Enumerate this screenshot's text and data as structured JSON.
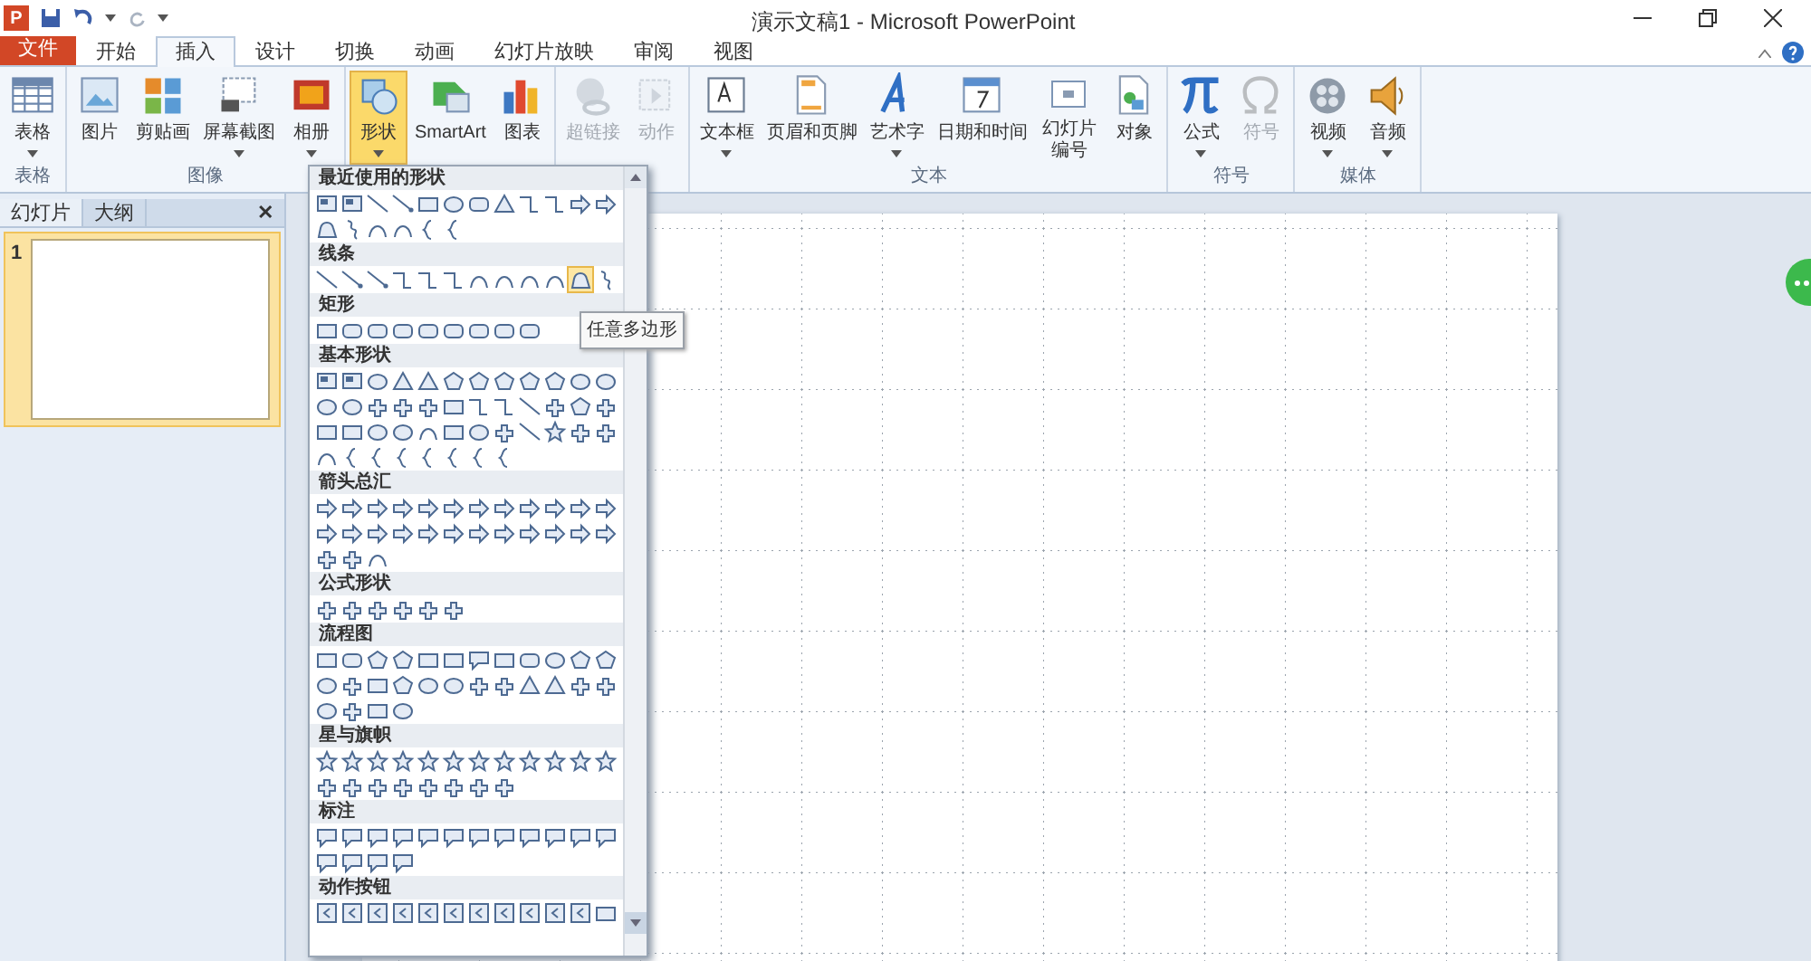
{
  "window": {
    "logo": "P",
    "title": "演示文稿1 - Microsoft PowerPoint"
  },
  "file_tab": "文件",
  "tabs": [
    {
      "label": "开始",
      "selected": false
    },
    {
      "label": "插入",
      "selected": true
    },
    {
      "label": "设计",
      "selected": false
    },
    {
      "label": "切换",
      "selected": false
    },
    {
      "label": "动画",
      "selected": false
    },
    {
      "label": "幻灯片放映",
      "selected": false
    },
    {
      "label": "审阅",
      "selected": false
    },
    {
      "label": "视图",
      "selected": false
    }
  ],
  "ribbon": [
    {
      "label": "表格",
      "buttons": [
        {
          "label": "表格",
          "dropdown": true,
          "disabled": false,
          "pressed": false
        }
      ]
    },
    {
      "label": "图像",
      "buttons": [
        {
          "label": "图片",
          "dropdown": false,
          "disabled": false,
          "pressed": false
        },
        {
          "label": "剪贴画",
          "dropdown": false,
          "disabled": false,
          "pressed": false
        },
        {
          "label": "屏幕截图",
          "dropdown": true,
          "disabled": false,
          "pressed": false
        },
        {
          "label": "相册",
          "dropdown": true,
          "disabled": false,
          "pressed": false
        }
      ]
    },
    {
      "buttons": [
        {
          "label": "形状",
          "dropdown": true,
          "disabled": false,
          "pressed": true
        },
        {
          "label": "SmartArt",
          "dropdown": false,
          "disabled": false,
          "pressed": false
        },
        {
          "label": "图表",
          "dropdown": false,
          "disabled": false,
          "pressed": false
        }
      ]
    },
    {
      "buttons": [
        {
          "label": "超链接",
          "dropdown": false,
          "disabled": true,
          "pressed": false
        },
        {
          "label": "动作",
          "dropdown": false,
          "disabled": true,
          "pressed": false
        }
      ]
    },
    {
      "label": "文本",
      "buttons": [
        {
          "label": "文本框",
          "dropdown": true,
          "disabled": false,
          "pressed": false
        },
        {
          "label": "页眉和页脚",
          "dropdown": false,
          "disabled": false,
          "pressed": false
        },
        {
          "label": "艺术字",
          "dropdown": true,
          "disabled": false,
          "pressed": false
        },
        {
          "label": "日期和时间",
          "dropdown": false,
          "disabled": false,
          "pressed": false
        },
        {
          "label": "幻灯片编号",
          "dropdown": false,
          "disabled": false,
          "pressed": false
        },
        {
          "label": "对象",
          "dropdown": false,
          "disabled": false,
          "pressed": false
        }
      ]
    },
    {
      "label": "符号",
      "buttons": [
        {
          "label": "公式",
          "dropdown": true,
          "disabled": false,
          "pressed": false
        },
        {
          "label": "符号",
          "dropdown": false,
          "disabled": true,
          "pressed": false
        }
      ]
    },
    {
      "label": "媒体",
      "buttons": [
        {
          "label": "视频",
          "dropdown": true,
          "disabled": false,
          "pressed": false
        },
        {
          "label": "音频",
          "dropdown": true,
          "disabled": false,
          "pressed": false
        }
      ]
    }
  ],
  "side_panel": {
    "tabs": [
      {
        "label": "幻灯片",
        "selected": true
      },
      {
        "label": "大纲",
        "selected": false
      }
    ],
    "close": "✕",
    "slides": [
      {
        "number": "1",
        "selected": true
      }
    ]
  },
  "shapes_gallery": {
    "sections": [
      {
        "title": "最近使用的形状",
        "shapes": [
          {
            "kind": "image"
          },
          {
            "kind": "image"
          },
          {
            "kind": "line"
          },
          {
            "kind": "arrowline"
          },
          {
            "kind": "rect"
          },
          {
            "kind": "oval"
          },
          {
            "kind": "round"
          },
          {
            "kind": "triangle"
          },
          {
            "kind": "elbow"
          },
          {
            "kind": "elbow"
          },
          {
            "kind": "arrow"
          },
          {
            "kind": "arrow"
          },
          {
            "kind": "freeform"
          },
          {
            "kind": "scribble"
          },
          {
            "kind": "curve"
          },
          {
            "kind": "curve"
          },
          {
            "kind": "brace"
          },
          {
            "kind": "brace"
          }
        ]
      },
      {
        "title": "线条",
        "shapes": [
          {
            "kind": "line",
            "selected": false
          },
          {
            "kind": "arrowline",
            "selected": false
          },
          {
            "kind": "arrowline",
            "selected": false
          },
          {
            "kind": "elbow",
            "selected": false
          },
          {
            "kind": "elbow",
            "selected": false
          },
          {
            "kind": "elbow",
            "selected": false
          },
          {
            "kind": "curve",
            "selected": false
          },
          {
            "kind": "curve",
            "selected": false
          },
          {
            "kind": "curve",
            "selected": false
          },
          {
            "kind": "curve",
            "selected": false
          },
          {
            "kind": "freeform",
            "selected": true
          },
          {
            "kind": "scribble",
            "selected": false
          }
        ]
      },
      {
        "title": "矩形",
        "shapes": [
          {
            "kind": "rect"
          },
          {
            "kind": "round"
          },
          {
            "kind": "round"
          },
          {
            "kind": "round"
          },
          {
            "kind": "round"
          },
          {
            "kind": "round"
          },
          {
            "kind": "round"
          },
          {
            "kind": "round"
          },
          {
            "kind": "round"
          }
        ]
      },
      {
        "title": "基本形状",
        "shapes": [
          {
            "kind": "image"
          },
          {
            "kind": "image"
          },
          {
            "kind": "oval"
          },
          {
            "kind": "triangle"
          },
          {
            "kind": "triangle"
          },
          {
            "kind": "polygon"
          },
          {
            "kind": "polygon"
          },
          {
            "kind": "polygon"
          },
          {
            "kind": "polygon"
          },
          {
            "kind": "polygon"
          },
          {
            "kind": "oval"
          },
          {
            "kind": "oval"
          },
          {
            "kind": "oval"
          },
          {
            "kind": "oval"
          },
          {
            "kind": "misc"
          },
          {
            "kind": "misc"
          },
          {
            "kind": "misc"
          },
          {
            "kind": "rect"
          },
          {
            "kind": "elbow"
          },
          {
            "kind": "elbow"
          },
          {
            "kind": "line"
          },
          {
            "kind": "misc"
          },
          {
            "kind": "polygon"
          },
          {
            "kind": "misc"
          },
          {
            "kind": "rect"
          },
          {
            "kind": "rect"
          },
          {
            "kind": "oval"
          },
          {
            "kind": "oval"
          },
          {
            "kind": "curve"
          },
          {
            "kind": "rect"
          },
          {
            "kind": "oval"
          },
          {
            "kind": "misc"
          },
          {
            "kind": "line"
          },
          {
            "kind": "star"
          },
          {
            "kind": "misc"
          },
          {
            "kind": "misc"
          },
          {
            "kind": "curve"
          },
          {
            "kind": "brace"
          },
          {
            "kind": "brace"
          },
          {
            "kind": "brace"
          },
          {
            "kind": "brace"
          },
          {
            "kind": "brace"
          },
          {
            "kind": "brace"
          },
          {
            "kind": "brace"
          }
        ]
      },
      {
        "title": "箭头总汇",
        "shapes": [
          {
            "kind": "arrow"
          },
          {
            "kind": "arrow"
          },
          {
            "kind": "arrow"
          },
          {
            "kind": "arrow"
          },
          {
            "kind": "arrow"
          },
          {
            "kind": "arrow"
          },
          {
            "kind": "arrow"
          },
          {
            "kind": "arrow"
          },
          {
            "kind": "arrow"
          },
          {
            "kind": "arrow"
          },
          {
            "kind": "arrow"
          },
          {
            "kind": "arrow"
          },
          {
            "kind": "arrow"
          },
          {
            "kind": "arrow"
          },
          {
            "kind": "arrow"
          },
          {
            "kind": "arrow"
          },
          {
            "kind": "arrow"
          },
          {
            "kind": "arrow"
          },
          {
            "kind": "arrow"
          },
          {
            "kind": "arrow"
          },
          {
            "kind": "arrow"
          },
          {
            "kind": "arrow"
          },
          {
            "kind": "arrow"
          },
          {
            "kind": "arrow"
          },
          {
            "kind": "misc"
          },
          {
            "kind": "misc"
          },
          {
            "kind": "curve"
          }
        ]
      },
      {
        "title": "公式形状",
        "shapes": [
          {
            "kind": "misc"
          },
          {
            "kind": "misc"
          },
          {
            "kind": "misc"
          },
          {
            "kind": "misc"
          },
          {
            "kind": "misc"
          },
          {
            "kind": "misc"
          }
        ]
      },
      {
        "title": "流程图",
        "shapes": [
          {
            "kind": "rect"
          },
          {
            "kind": "round"
          },
          {
            "kind": "polygon"
          },
          {
            "kind": "polygon"
          },
          {
            "kind": "rect"
          },
          {
            "kind": "rect"
          },
          {
            "kind": "callout"
          },
          {
            "kind": "rect"
          },
          {
            "kind": "round"
          },
          {
            "kind": "oval"
          },
          {
            "kind": "polygon"
          },
          {
            "kind": "polygon"
          },
          {
            "kind": "oval"
          },
          {
            "kind": "misc"
          },
          {
            "kind": "rect"
          },
          {
            "kind": "polygon"
          },
          {
            "kind": "oval"
          },
          {
            "kind": "oval"
          },
          {
            "kind": "misc"
          },
          {
            "kind": "misc"
          },
          {
            "kind": "triangle"
          },
          {
            "kind": "triangle"
          },
          {
            "kind": "misc"
          },
          {
            "kind": "misc"
          },
          {
            "kind": "oval"
          },
          {
            "kind": "misc"
          },
          {
            "kind": "rect"
          },
          {
            "kind": "oval"
          }
        ]
      },
      {
        "title": "星与旗帜",
        "shapes": [
          {
            "kind": "star"
          },
          {
            "kind": "star"
          },
          {
            "kind": "star"
          },
          {
            "kind": "star"
          },
          {
            "kind": "star"
          },
          {
            "kind": "star"
          },
          {
            "kind": "star"
          },
          {
            "kind": "star"
          },
          {
            "kind": "star"
          },
          {
            "kind": "star"
          },
          {
            "kind": "star"
          },
          {
            "kind": "star"
          },
          {
            "kind": "misc"
          },
          {
            "kind": "misc"
          },
          {
            "kind": "misc"
          },
          {
            "kind": "misc"
          },
          {
            "kind": "misc"
          },
          {
            "kind": "misc"
          },
          {
            "kind": "misc"
          },
          {
            "kind": "misc"
          }
        ]
      },
      {
        "title": "标注",
        "shapes": [
          {
            "kind": "callout"
          },
          {
            "kind": "callout"
          },
          {
            "kind": "callout"
          },
          {
            "kind": "callout"
          },
          {
            "kind": "callout"
          },
          {
            "kind": "callout"
          },
          {
            "kind": "callout"
          },
          {
            "kind": "callout"
          },
          {
            "kind": "callout"
          },
          {
            "kind": "callout"
          },
          {
            "kind": "callout"
          },
          {
            "kind": "callout"
          },
          {
            "kind": "callout"
          },
          {
            "kind": "callout"
          },
          {
            "kind": "callout"
          },
          {
            "kind": "callout"
          }
        ]
      },
      {
        "title": "动作按钮",
        "shapes": [
          {
            "kind": "button"
          },
          {
            "kind": "button"
          },
          {
            "kind": "button"
          },
          {
            "kind": "button"
          },
          {
            "kind": "button"
          },
          {
            "kind": "button"
          },
          {
            "kind": "button"
          },
          {
            "kind": "button"
          },
          {
            "kind": "button"
          },
          {
            "kind": "button"
          },
          {
            "kind": "button"
          },
          {
            "kind": "rect"
          }
        ]
      }
    ]
  },
  "tooltip": "任意多边形"
}
